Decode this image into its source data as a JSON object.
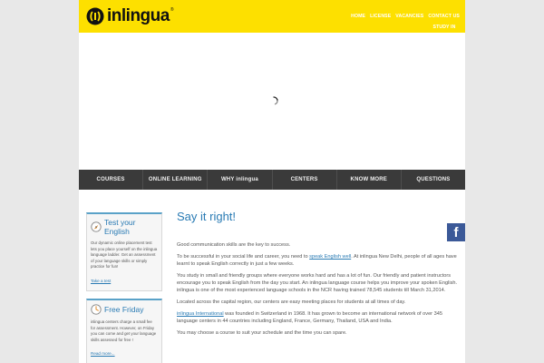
{
  "header": {
    "logo_text": "inlingua",
    "logo_reg": "®",
    "topnav": [
      "HOME",
      "LICENSE",
      "VACANCIES",
      "CONTACT US",
      "STUDY IN INDIA"
    ]
  },
  "mainnav": [
    "COURSES",
    "ONLINE LEARNING",
    "WHY inlingua",
    "CENTERS",
    "KNOW MORE",
    "QUESTIONS"
  ],
  "sidebar": {
    "test": {
      "title": "Test your English",
      "text": "Our dynamic online placement test lets you place yourself on the inlingua language ladder. Get an assessment of your language skills or simply practice for fun!",
      "link": "Take a test"
    },
    "friday": {
      "title": "Free Friday",
      "text": "inlingua centers charge a small fee for assessment. However, on Friday you can come and get your language skills assessed for free !",
      "link": "Read more..."
    }
  },
  "article": {
    "title": "Say it right!",
    "p1": "Good communication skills are the key to success.",
    "p2_before": "To be successful in your social life and career, you need to ",
    "p2_link": "speak English well",
    "p2_after": ". At inlingua New Delhi, people of all ages have learnt to speak English correctly in just a few weeks.",
    "p3": "You study in small and friendly groups where everyone works hard and has a lot of fun. Our friendly and patient instructors encourage you to speak English from the day you start. An inlingua language course helps you improve your spoken English. inlingua is one of the most experienced language schools in the NCR having trained 78,545 students till March 31,2014.",
    "p4": "Located across the capital region, our centers are easy meeting places for students at all times of day.",
    "p5_link": "inlingua International",
    "p5_after": " was founded in Switzerland in 1968. It has grown to become an international network of over 345 language centers in 44 countries including England, France, Germany, Thailand, USA and India.",
    "p6": "You may choose a course to suit your schedule and the time you can spare."
  },
  "social": {
    "facebook_letter": "f"
  },
  "colors": {
    "header": "#fde000",
    "nav": "#3a3a3a",
    "accent": "#2a7bb4",
    "facebook": "#3b5998"
  }
}
